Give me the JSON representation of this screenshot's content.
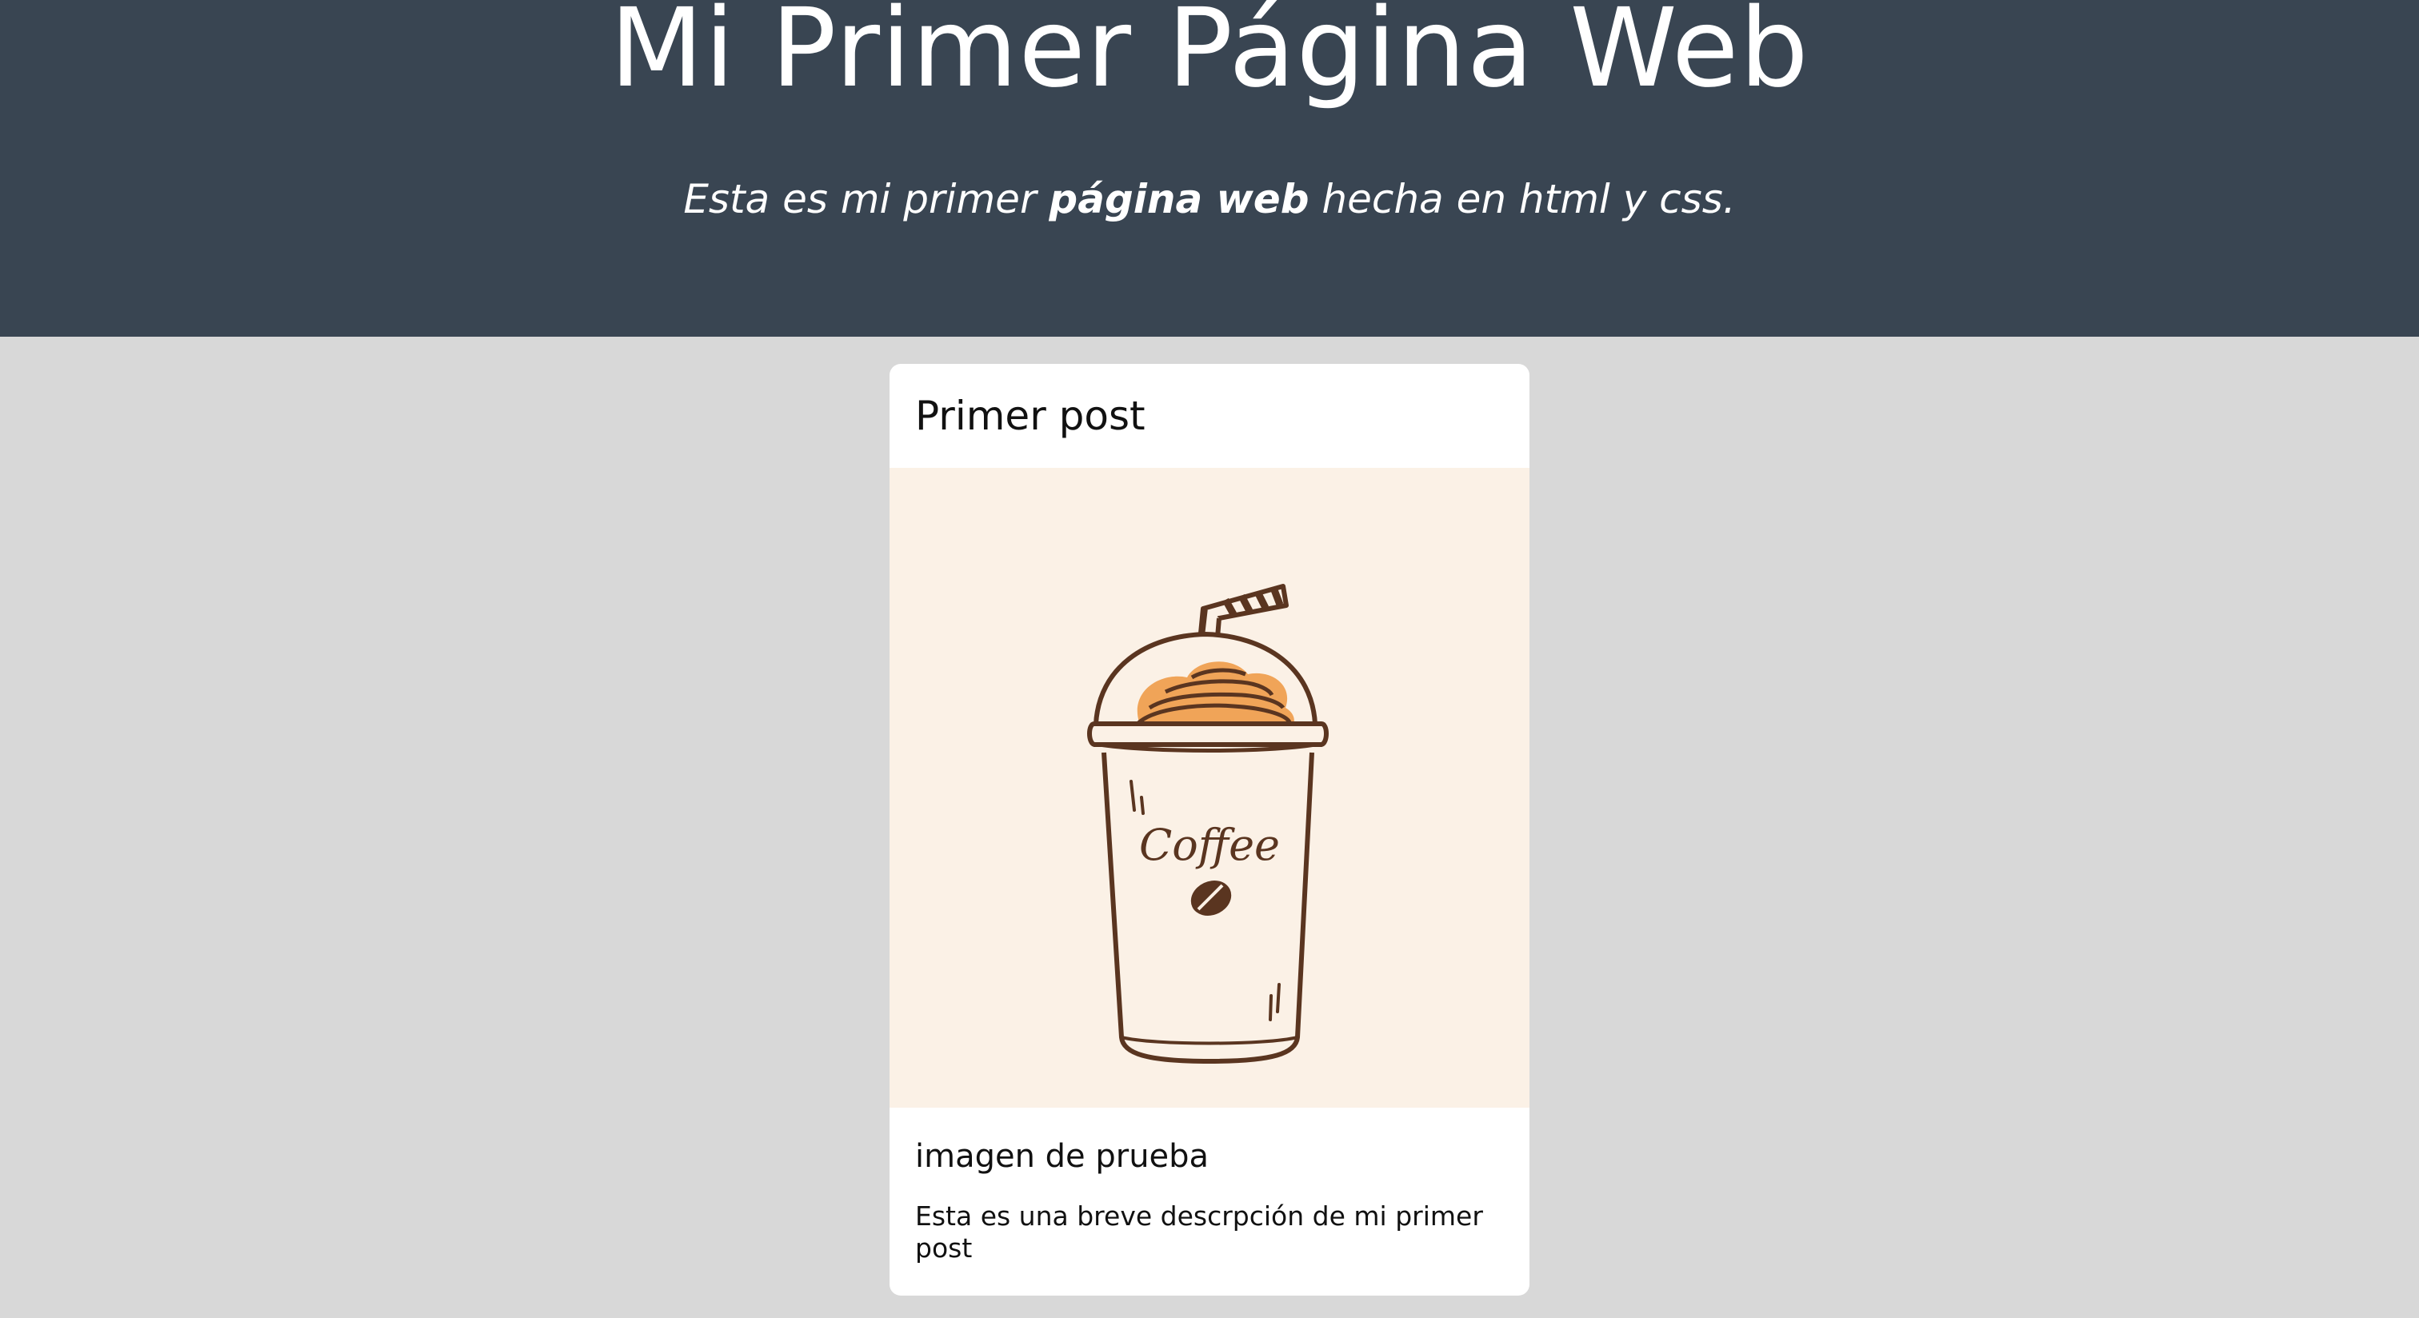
{
  "header": {
    "title": "Mi Primer Página Web",
    "subtitle_part1": "Esta es mi primer ",
    "subtitle_bold": "página web",
    "subtitle_part2": " hecha en html y css.",
    "background": "#394552"
  },
  "post": {
    "title": "Primer post",
    "image": {
      "icon": "coffee-cup-illustration",
      "cup_text": "Coffee",
      "background": "#fbf1e6",
      "line_color": "#5a3520",
      "cream_color": "#f0a458"
    },
    "subtitle": "imagen de prueba",
    "description": "Esta es una breve descrpción de mi primer post"
  },
  "page": {
    "background": "#d8d8d8"
  }
}
